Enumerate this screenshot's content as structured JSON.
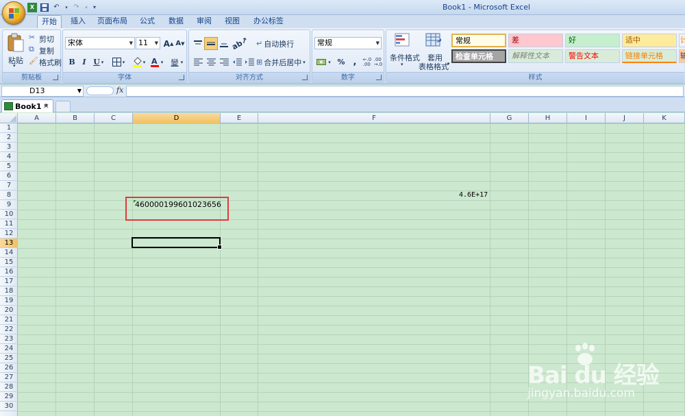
{
  "window": {
    "title": "Book1 - Microsoft Excel"
  },
  "qat": {
    "save": "save-icon",
    "undo": "undo-icon",
    "redo": "redo-icon",
    "customize": "▾"
  },
  "tabs": [
    {
      "label": "开始",
      "active": true
    },
    {
      "label": "插入"
    },
    {
      "label": "页面布局"
    },
    {
      "label": "公式"
    },
    {
      "label": "数据"
    },
    {
      "label": "审阅"
    },
    {
      "label": "视图"
    },
    {
      "label": "办公标签"
    }
  ],
  "ribbon": {
    "clipboard": {
      "label": "剪贴板",
      "paste": "粘贴",
      "cut": "剪切",
      "copy": "复制",
      "format_painter": "格式刷"
    },
    "font": {
      "label": "字体",
      "name": "宋体",
      "size": "11",
      "bold": "B",
      "italic": "I",
      "underline": "U",
      "grow": "A",
      "shrink": "A",
      "wen": "變"
    },
    "alignment": {
      "label": "对齐方式",
      "wrap": "自动换行",
      "merge": "合并后居中"
    },
    "number": {
      "label": "数字",
      "format": "常规",
      "percent": "%",
      "comma": ","
    },
    "styles": {
      "label": "样式",
      "conditional": "条件格式",
      "table_line1": "套用",
      "table_line2": "表格格式",
      "cells": [
        {
          "text": "常规",
          "bg": "#ffffff",
          "fg": "#000000"
        },
        {
          "text": "差",
          "bg": "#ffc7ce",
          "fg": "#9c0006"
        },
        {
          "text": "好",
          "bg": "#c6efce",
          "fg": "#006100"
        },
        {
          "text": "适中",
          "bg": "#ffeb9c",
          "fg": "#9c5700"
        },
        {
          "text": "计",
          "bg": "#f2f2f2",
          "fg": "#fa7d00"
        },
        {
          "text": "检查单元格",
          "bg": "#a5a5a5",
          "fg": "#ffffff"
        },
        {
          "text": "解释性文本",
          "bg": "#ffffff",
          "fg": "#7f7f7f"
        },
        {
          "text": "警告文本",
          "bg": "#ffffff",
          "fg": "#ff0000"
        },
        {
          "text": "链接单元格",
          "bg": "#ffffff",
          "fg": "#fa7d00"
        },
        {
          "text": "输",
          "bg": "#ffcc99",
          "fg": "#3f3f76"
        }
      ]
    }
  },
  "formula_bar": {
    "name_box": "D13",
    "fx": "fx",
    "content": ""
  },
  "workbook_tab": {
    "label": "Book1 *",
    "close": "×"
  },
  "columns": [
    "A",
    "B",
    "C",
    "D",
    "E",
    "F",
    "G",
    "H",
    "I",
    "J",
    "K"
  ],
  "rows": [
    "1",
    "2",
    "3",
    "4",
    "5",
    "6",
    "7",
    "8",
    "9",
    "10",
    "11",
    "12",
    "13",
    "14",
    "15",
    "16",
    "17",
    "18",
    "19",
    "20",
    "21",
    "22",
    "23",
    "24",
    "25",
    "26",
    "27",
    "28",
    "29",
    "30"
  ],
  "selected_cell": {
    "column": "D",
    "row": "13"
  },
  "cells": {
    "D9": "460000199601023656",
    "F8": "4.6E+17"
  },
  "watermark": {
    "main": "Bai du 经验",
    "sub": "jingyan.baidu.com"
  }
}
